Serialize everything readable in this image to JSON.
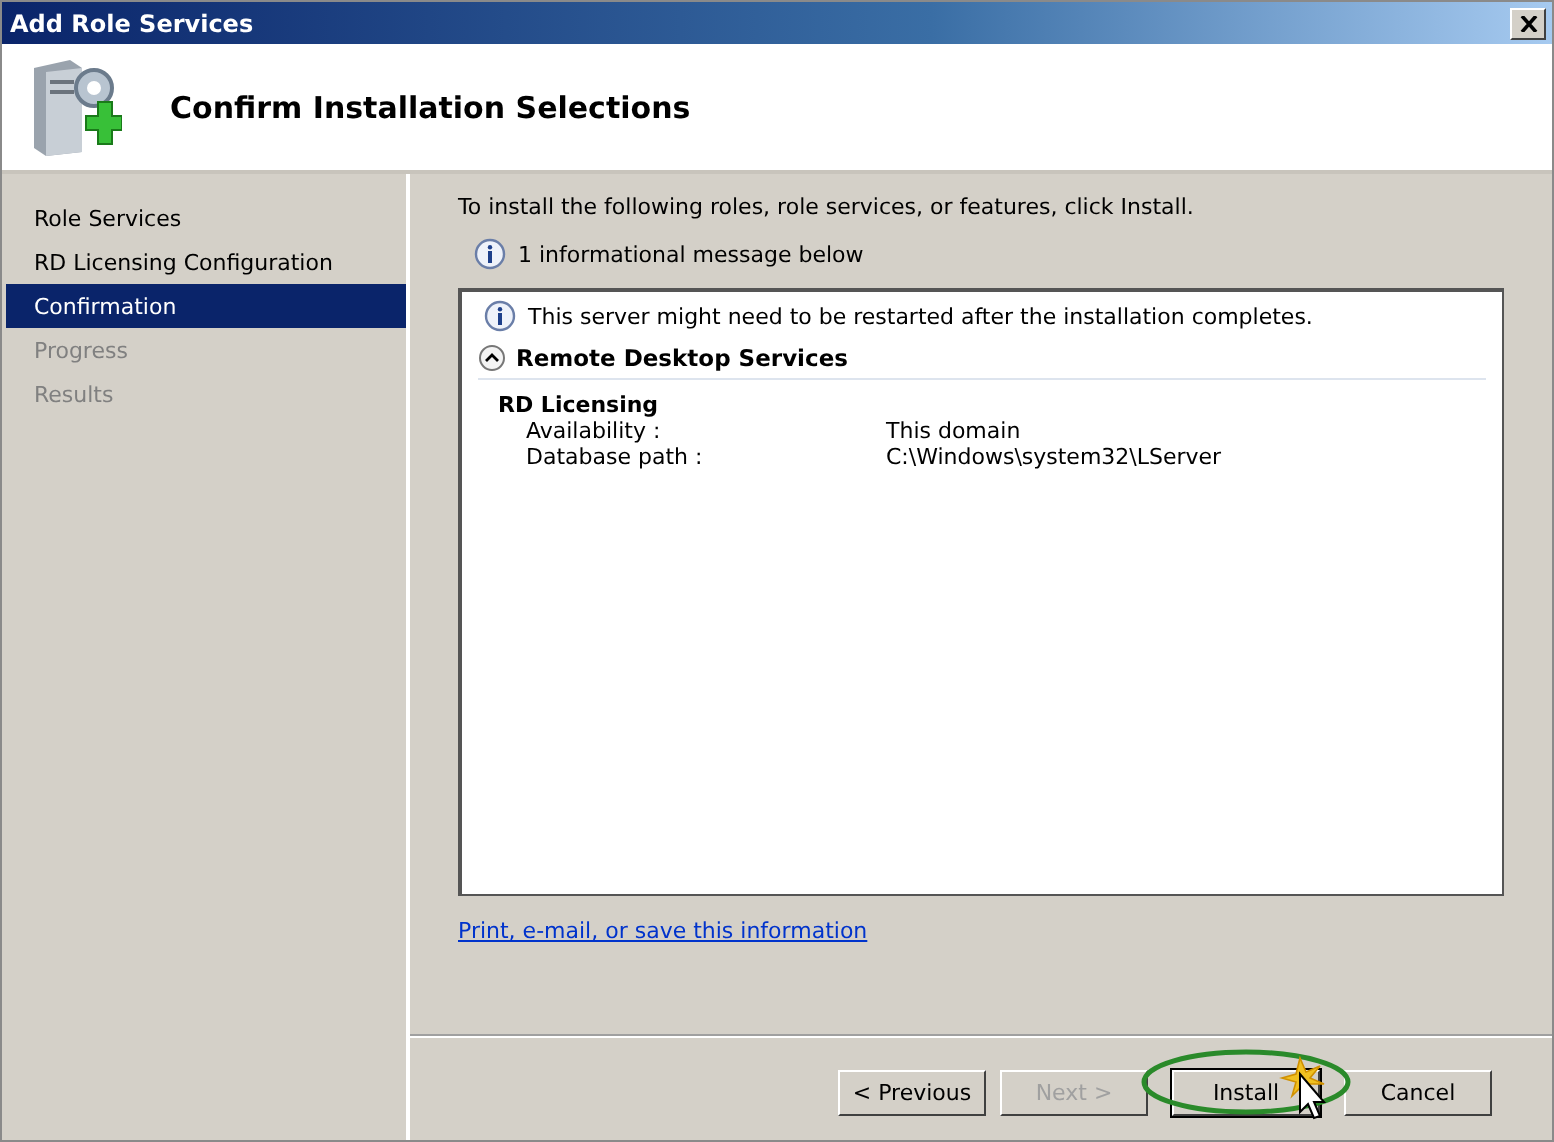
{
  "window": {
    "title": "Add Role Services"
  },
  "header": {
    "title": "Confirm Installation Selections"
  },
  "steps": [
    {
      "label": "Role Services",
      "selected": false,
      "disabled": false
    },
    {
      "label": "RD Licensing Configuration",
      "selected": false,
      "disabled": false
    },
    {
      "label": "Confirmation",
      "selected": true,
      "disabled": false
    },
    {
      "label": "Progress",
      "selected": false,
      "disabled": true
    },
    {
      "label": "Results",
      "selected": false,
      "disabled": true
    }
  ],
  "content": {
    "intro": "To install the following roles, role services, or features, click Install.",
    "message_count": "1 informational message below",
    "details": {
      "notice": "This server might need to be restarted after the installation completes.",
      "section": {
        "title": "Remote Desktop Services",
        "expanded": true,
        "groups": [
          {
            "name": "RD Licensing",
            "rows": [
              {
                "label": "Availability :",
                "value": "This domain"
              },
              {
                "label": "Database path :",
                "value": "C:\\Windows\\system32\\LServer"
              }
            ]
          }
        ]
      }
    },
    "link": "Print, e-mail, or save this information"
  },
  "buttons": [
    {
      "label": "< Previous",
      "disabled": false,
      "highlighted": false
    },
    {
      "label": "Next >",
      "disabled": true,
      "highlighted": false
    },
    {
      "label": "Install",
      "disabled": false,
      "highlighted": true
    },
    {
      "label": "Cancel",
      "disabled": false,
      "highlighted": false
    }
  ]
}
